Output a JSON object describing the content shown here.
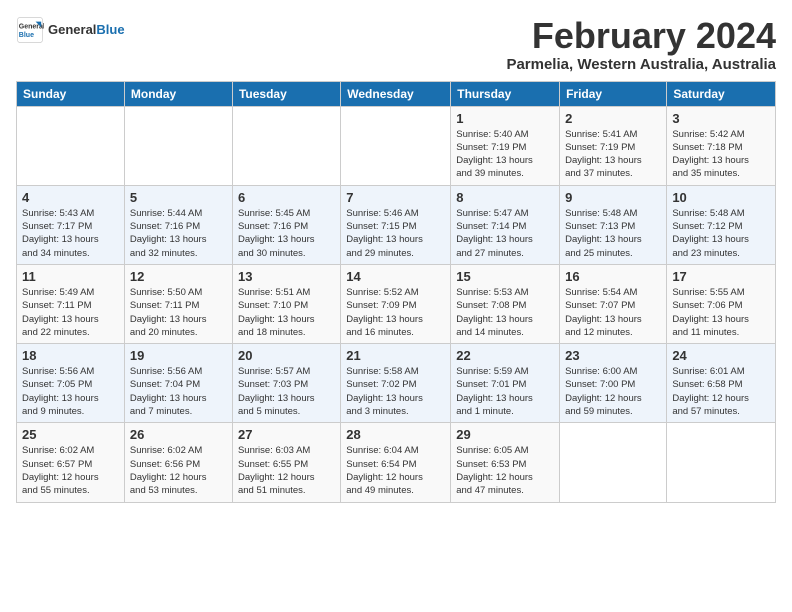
{
  "logo": {
    "name_general": "General",
    "name_blue": "Blue"
  },
  "header": {
    "title": "February 2024",
    "subtitle": "Parmelia, Western Australia, Australia"
  },
  "weekdays": [
    "Sunday",
    "Monday",
    "Tuesday",
    "Wednesday",
    "Thursday",
    "Friday",
    "Saturday"
  ],
  "weeks": [
    [
      {
        "day": "",
        "info": ""
      },
      {
        "day": "",
        "info": ""
      },
      {
        "day": "",
        "info": ""
      },
      {
        "day": "",
        "info": ""
      },
      {
        "day": "1",
        "info": "Sunrise: 5:40 AM\nSunset: 7:19 PM\nDaylight: 13 hours\nand 39 minutes."
      },
      {
        "day": "2",
        "info": "Sunrise: 5:41 AM\nSunset: 7:19 PM\nDaylight: 13 hours\nand 37 minutes."
      },
      {
        "day": "3",
        "info": "Sunrise: 5:42 AM\nSunset: 7:18 PM\nDaylight: 13 hours\nand 35 minutes."
      }
    ],
    [
      {
        "day": "4",
        "info": "Sunrise: 5:43 AM\nSunset: 7:17 PM\nDaylight: 13 hours\nand 34 minutes."
      },
      {
        "day": "5",
        "info": "Sunrise: 5:44 AM\nSunset: 7:16 PM\nDaylight: 13 hours\nand 32 minutes."
      },
      {
        "day": "6",
        "info": "Sunrise: 5:45 AM\nSunset: 7:16 PM\nDaylight: 13 hours\nand 30 minutes."
      },
      {
        "day": "7",
        "info": "Sunrise: 5:46 AM\nSunset: 7:15 PM\nDaylight: 13 hours\nand 29 minutes."
      },
      {
        "day": "8",
        "info": "Sunrise: 5:47 AM\nSunset: 7:14 PM\nDaylight: 13 hours\nand 27 minutes."
      },
      {
        "day": "9",
        "info": "Sunrise: 5:48 AM\nSunset: 7:13 PM\nDaylight: 13 hours\nand 25 minutes."
      },
      {
        "day": "10",
        "info": "Sunrise: 5:48 AM\nSunset: 7:12 PM\nDaylight: 13 hours\nand 23 minutes."
      }
    ],
    [
      {
        "day": "11",
        "info": "Sunrise: 5:49 AM\nSunset: 7:11 PM\nDaylight: 13 hours\nand 22 minutes."
      },
      {
        "day": "12",
        "info": "Sunrise: 5:50 AM\nSunset: 7:11 PM\nDaylight: 13 hours\nand 20 minutes."
      },
      {
        "day": "13",
        "info": "Sunrise: 5:51 AM\nSunset: 7:10 PM\nDaylight: 13 hours\nand 18 minutes."
      },
      {
        "day": "14",
        "info": "Sunrise: 5:52 AM\nSunset: 7:09 PM\nDaylight: 13 hours\nand 16 minutes."
      },
      {
        "day": "15",
        "info": "Sunrise: 5:53 AM\nSunset: 7:08 PM\nDaylight: 13 hours\nand 14 minutes."
      },
      {
        "day": "16",
        "info": "Sunrise: 5:54 AM\nSunset: 7:07 PM\nDaylight: 13 hours\nand 12 minutes."
      },
      {
        "day": "17",
        "info": "Sunrise: 5:55 AM\nSunset: 7:06 PM\nDaylight: 13 hours\nand 11 minutes."
      }
    ],
    [
      {
        "day": "18",
        "info": "Sunrise: 5:56 AM\nSunset: 7:05 PM\nDaylight: 13 hours\nand 9 minutes."
      },
      {
        "day": "19",
        "info": "Sunrise: 5:56 AM\nSunset: 7:04 PM\nDaylight: 13 hours\nand 7 minutes."
      },
      {
        "day": "20",
        "info": "Sunrise: 5:57 AM\nSunset: 7:03 PM\nDaylight: 13 hours\nand 5 minutes."
      },
      {
        "day": "21",
        "info": "Sunrise: 5:58 AM\nSunset: 7:02 PM\nDaylight: 13 hours\nand 3 minutes."
      },
      {
        "day": "22",
        "info": "Sunrise: 5:59 AM\nSunset: 7:01 PM\nDaylight: 13 hours\nand 1 minute."
      },
      {
        "day": "23",
        "info": "Sunrise: 6:00 AM\nSunset: 7:00 PM\nDaylight: 12 hours\nand 59 minutes."
      },
      {
        "day": "24",
        "info": "Sunrise: 6:01 AM\nSunset: 6:58 PM\nDaylight: 12 hours\nand 57 minutes."
      }
    ],
    [
      {
        "day": "25",
        "info": "Sunrise: 6:02 AM\nSunset: 6:57 PM\nDaylight: 12 hours\nand 55 minutes."
      },
      {
        "day": "26",
        "info": "Sunrise: 6:02 AM\nSunset: 6:56 PM\nDaylight: 12 hours\nand 53 minutes."
      },
      {
        "day": "27",
        "info": "Sunrise: 6:03 AM\nSunset: 6:55 PM\nDaylight: 12 hours\nand 51 minutes."
      },
      {
        "day": "28",
        "info": "Sunrise: 6:04 AM\nSunset: 6:54 PM\nDaylight: 12 hours\nand 49 minutes."
      },
      {
        "day": "29",
        "info": "Sunrise: 6:05 AM\nSunset: 6:53 PM\nDaylight: 12 hours\nand 47 minutes."
      },
      {
        "day": "",
        "info": ""
      },
      {
        "day": "",
        "info": ""
      }
    ]
  ]
}
